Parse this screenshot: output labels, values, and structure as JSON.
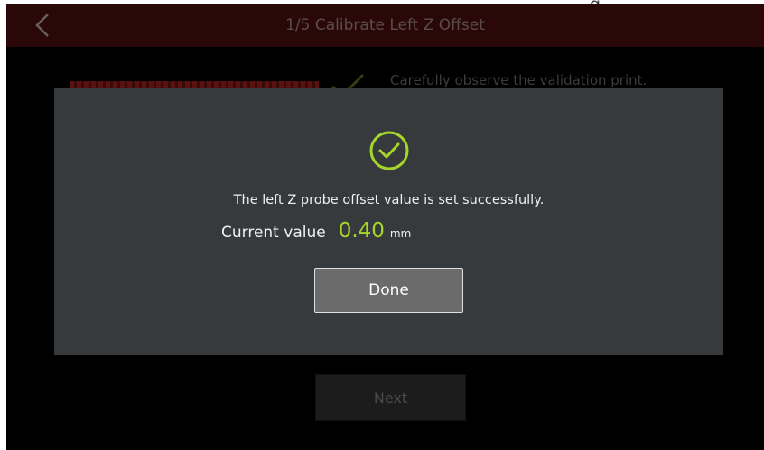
{
  "window": {
    "partial_caption": "g"
  },
  "header": {
    "title": "1/5 Calibrate Left Z Offset",
    "back_icon": "chevron-left-icon"
  },
  "background": {
    "instruction": "Carefully observe the validation print.",
    "check_icon": "checkmark-icon",
    "next_label": "Next"
  },
  "dialog": {
    "icon": "success-check-circle-icon",
    "message": "The left Z probe offset value is set successfully.",
    "value_label": "Current value",
    "value": "0.40",
    "unit": "mm",
    "done_label": "Done"
  },
  "colors": {
    "accent": "#a6d629",
    "dialog_bg": "#363a3c",
    "title_bar": "#2a0808",
    "button_bg": "#6b6b6b"
  }
}
